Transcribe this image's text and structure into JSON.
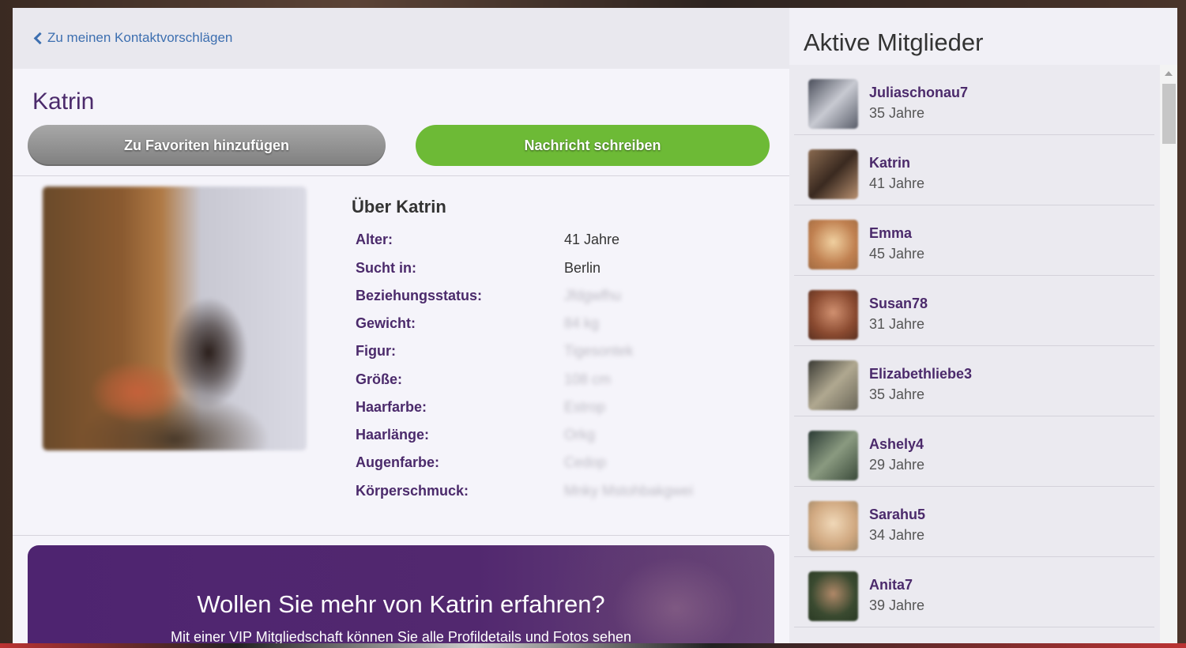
{
  "back_link": "Zu meinen Kontaktvorschlägen",
  "profile": {
    "name": "Katrin",
    "fav_button": "Zu Favoriten hinzufügen",
    "message_button": "Nachricht schreiben",
    "about_title": "Über Katrin",
    "details": [
      {
        "label": "Alter:",
        "value": "41 Jahre",
        "blurred": false
      },
      {
        "label": "Sucht in:",
        "value": "Berlin",
        "blurred": false
      },
      {
        "label": "Beziehungsstatus:",
        "value": "Jfdgwfhu",
        "blurred": true
      },
      {
        "label": "Gewicht:",
        "value": "84 kg",
        "blurred": true
      },
      {
        "label": "Figur:",
        "value": "Tigesontek",
        "blurred": true
      },
      {
        "label": "Größe:",
        "value": "108 cm",
        "blurred": true
      },
      {
        "label": "Haarfarbe:",
        "value": "Estrop",
        "blurred": true
      },
      {
        "label": "Haarlänge:",
        "value": "Orkg",
        "blurred": true
      },
      {
        "label": "Augenfarbe:",
        "value": "Cedop",
        "blurred": true
      },
      {
        "label": "Körperschmuck:",
        "value": "Mnky Mstohbakgwei",
        "blurred": true
      }
    ]
  },
  "promo": {
    "title": "Wollen Sie mehr von Katrin erfahren?",
    "subtitle": "Mit einer VIP Mitgliedschaft können Sie alle Profildetails und Fotos sehen"
  },
  "sidebar": {
    "title": "Aktive Mitglieder",
    "members": [
      {
        "name": "Juliaschonau7",
        "age": "35 Jahre",
        "color": "#8a8e9a"
      },
      {
        "name": "Katrin",
        "age": "41 Jahre",
        "color": "#6a5040"
      },
      {
        "name": "Emma",
        "age": "45 Jahre",
        "color": "#d8a070"
      },
      {
        "name": "Susan78",
        "age": "31 Jahre",
        "color": "#a06848"
      },
      {
        "name": "Elizabethliebe3",
        "age": "35 Jahre",
        "color": "#706c60"
      },
      {
        "name": "Ashely4",
        "age": "29 Jahre",
        "color": "#506050"
      },
      {
        "name": "Sarahu5",
        "age": "34 Jahre",
        "color": "#d0b088"
      },
      {
        "name": "Anita7",
        "age": "39 Jahre",
        "color": "#4a6040"
      }
    ]
  }
}
